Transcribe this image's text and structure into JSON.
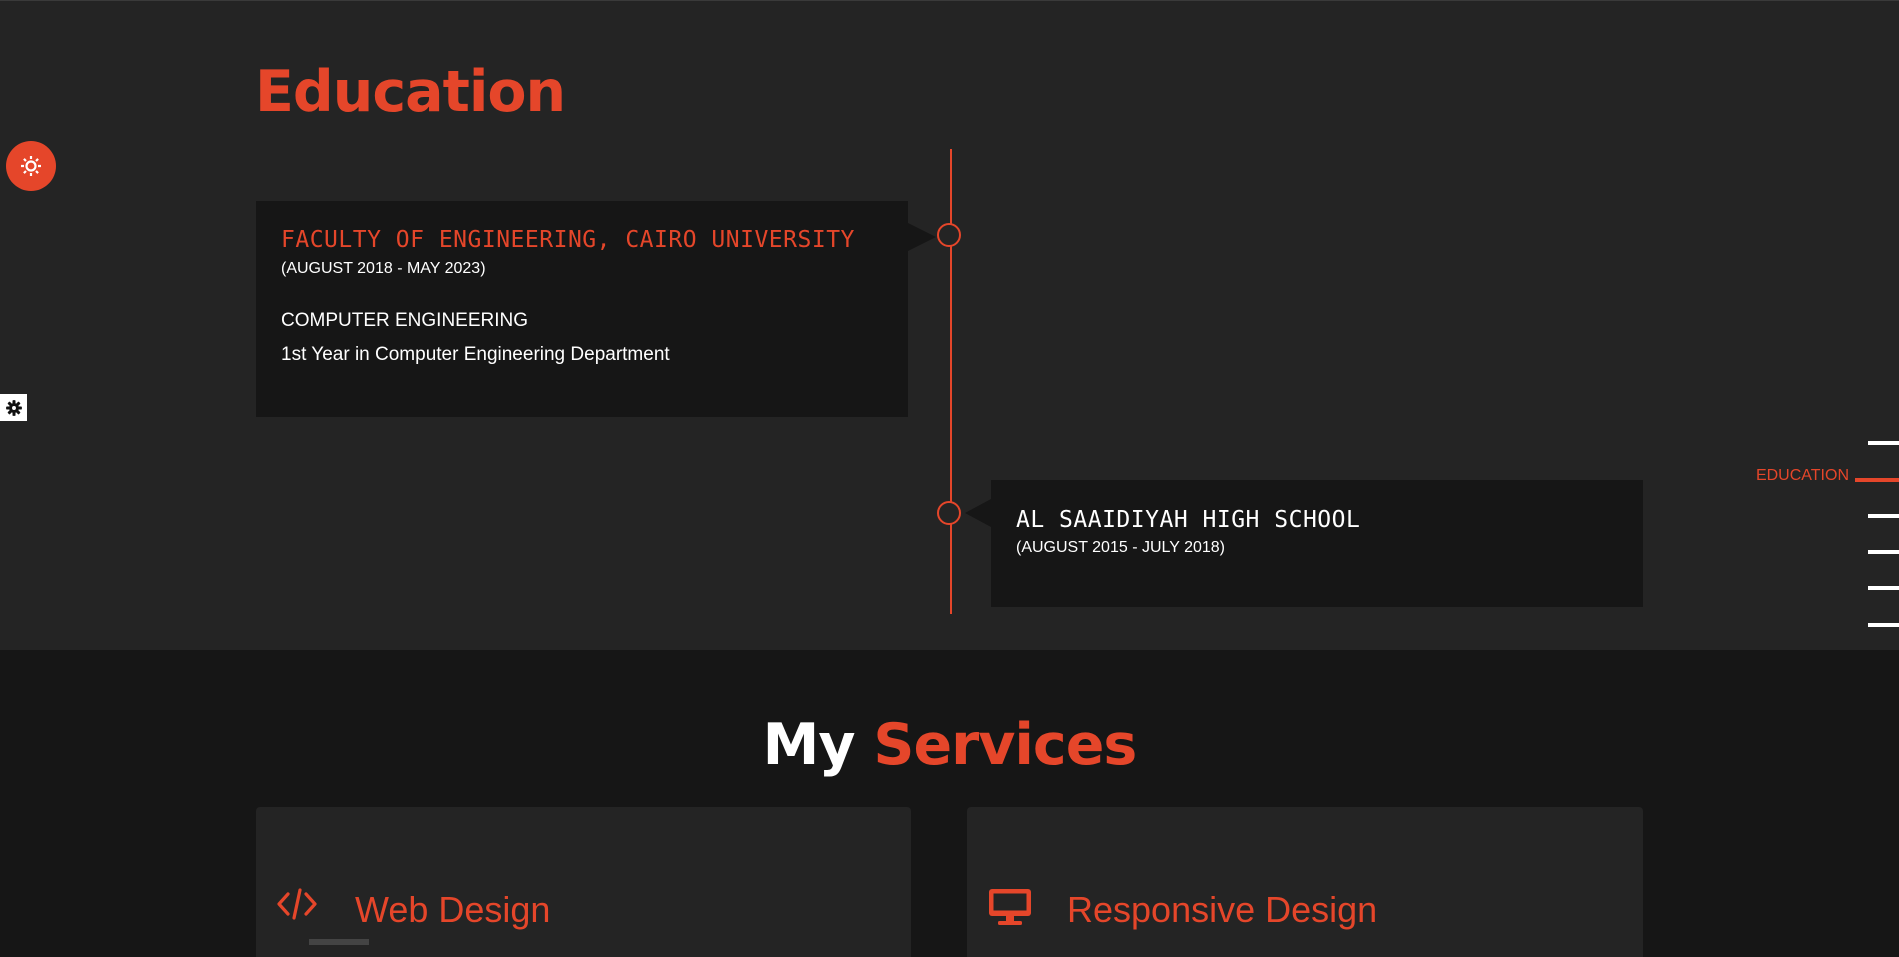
{
  "colors": {
    "accent": "#e5462a",
    "section_dark": "#161616",
    "section_mid": "#242424",
    "text": "#ffffff"
  },
  "education": {
    "title": "Education",
    "entries": [
      {
        "school": "FACULTY OF ENGINEERING, CAIRO UNIVERSITY",
        "dates": "(AUGUST 2018 - MAY 2023)",
        "degree": "COMPUTER ENGINEERING",
        "description": "1st Year in Computer Engineering Department"
      },
      {
        "school": "AL SAAIDIYAH HIGH SCHOOL",
        "dates": "(AUGUST 2015 - JULY 2018)"
      }
    ]
  },
  "settings": {
    "primary_icon": "gear-icon",
    "secondary_icon": "gear-icon"
  },
  "side_nav": {
    "active_label": "EDUCATION"
  },
  "services": {
    "title_white": "My",
    "title_accent": "Services",
    "items": [
      {
        "label": "Web Design",
        "icon": "code-icon"
      },
      {
        "label": "Responsive Design",
        "icon": "monitor-icon"
      }
    ]
  }
}
